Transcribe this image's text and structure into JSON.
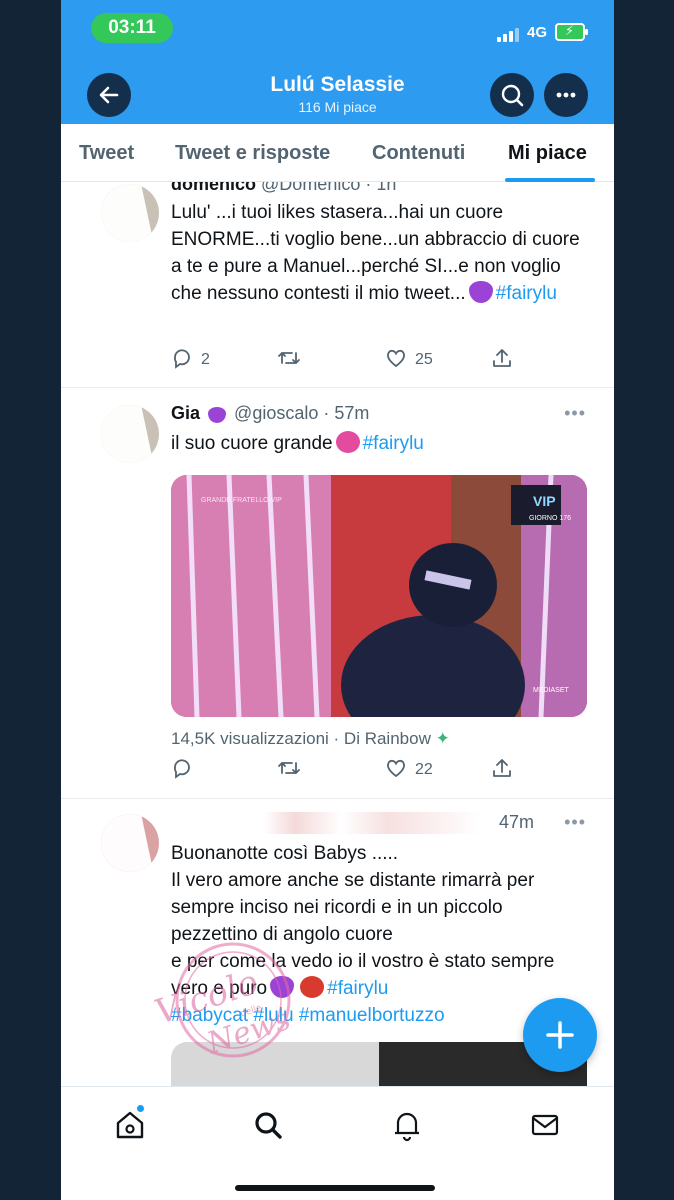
{
  "status_bar": {
    "time": "03:11",
    "network": "4G"
  },
  "header": {
    "title": "Lulú Selassie",
    "subtitle": "116 Mi piace",
    "back_icon": "arrow-left-icon",
    "search_icon": "search-icon",
    "more_icon": "more-horizontal-icon"
  },
  "tabs": [
    {
      "label": "Tweet",
      "active": false
    },
    {
      "label": "Tweet e risposte",
      "active": false
    },
    {
      "label": "Contenuti",
      "active": false
    },
    {
      "label": "Mi piace",
      "active": true
    }
  ],
  "tweets": [
    {
      "author": "domenico",
      "handle": "@Domenico",
      "time": "1h",
      "text": "Lulu' ...i tuoi likes stasera...hai un cuore ENORME...ti voglio bene...un abbraccio di cuore a te e pure a Manuel...perché SI...e non voglio che nessuno contesti il mio tweet...",
      "hashtags": "#fairylu",
      "replies": "2",
      "likes": "25"
    },
    {
      "author": "Gia",
      "handle": "@gioscalo",
      "time": "57m",
      "text": "il suo cuore grande",
      "hashtags": "#fairylu",
      "views": "14,5K visualizzazioni · Di Rainbow",
      "likes": "22",
      "media": {
        "logo_text": "VIP",
        "overlay_text": "GRANDE FRATELLO VIP",
        "day_label": "GIORNO 176",
        "network_label": "MEDIASET"
      }
    },
    {
      "time": "47m",
      "text_lines": [
        "Buonanotte così Babys  .....",
        "Il vero amore anche se distante rimarrà per sempre inciso nei ricordi e in un piccolo pezzettino  di angolo  cuore",
        "e per come la vedo io il vostro è stato sempre vero e puro"
      ],
      "hashtag_1": "#fairylu",
      "hashtags_2": "#babycat #lulu #manuelbortuzzo"
    }
  ],
  "watermark": {
    "line1": "Vicolo",
    "line2": "delle",
    "line3": "News"
  },
  "nav": [
    "home-icon",
    "search-icon",
    "bell-icon",
    "mail-icon"
  ],
  "colors": {
    "brand_blue": "#2d9bf0",
    "link": "#1d9bf0",
    "dark_button": "#142f4c"
  }
}
